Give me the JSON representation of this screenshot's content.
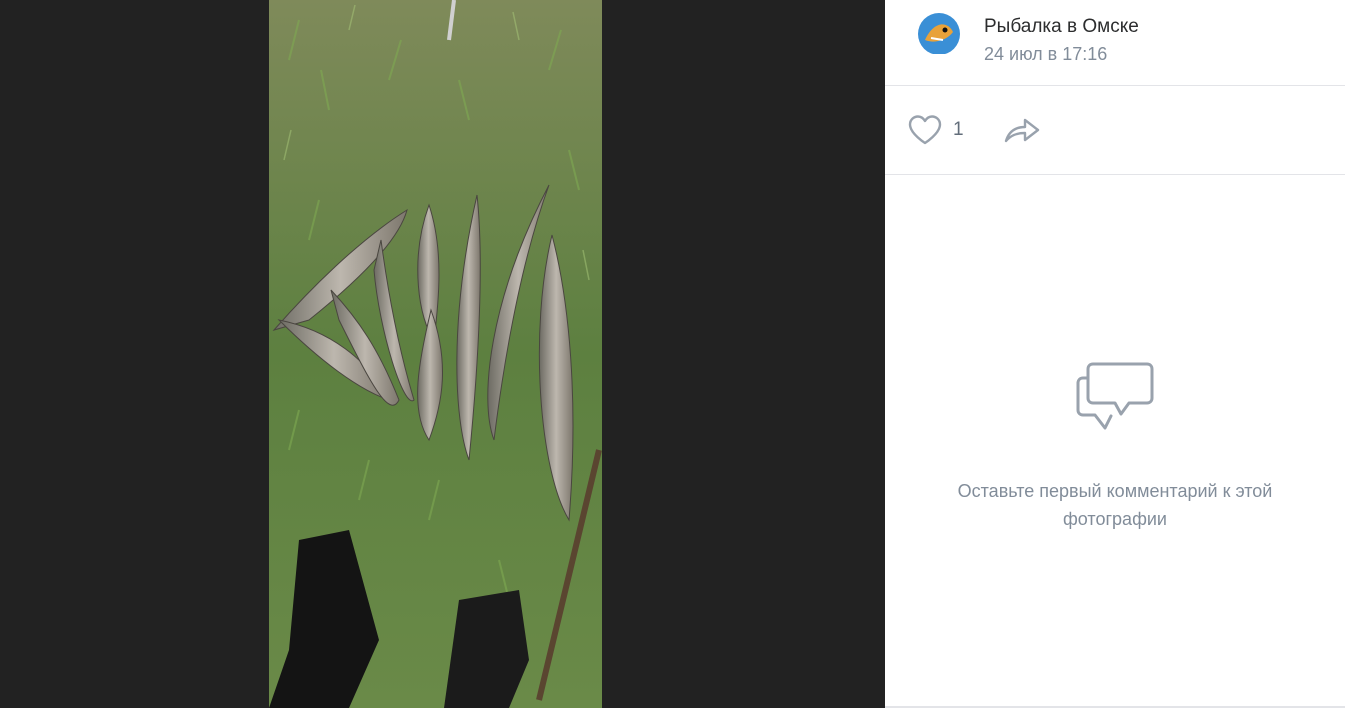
{
  "post": {
    "author": "Рыбалка в Омске",
    "date": "24 июл в 17:16",
    "avatar_text": "РЫБАЛКА В ОМСКЕ"
  },
  "actions": {
    "like_count": "1",
    "like_icon": "heart-icon",
    "share_icon": "share-arrow-icon"
  },
  "comments": {
    "empty_icon": "comment-bubbles-icon",
    "empty_text": "Оставьте первый комментарий к этой фотографии"
  },
  "colors": {
    "viewer_bg": "#222222",
    "text_primary": "#2c2d2e",
    "text_secondary": "#818c99",
    "icon_gray": "#99a2ad"
  }
}
